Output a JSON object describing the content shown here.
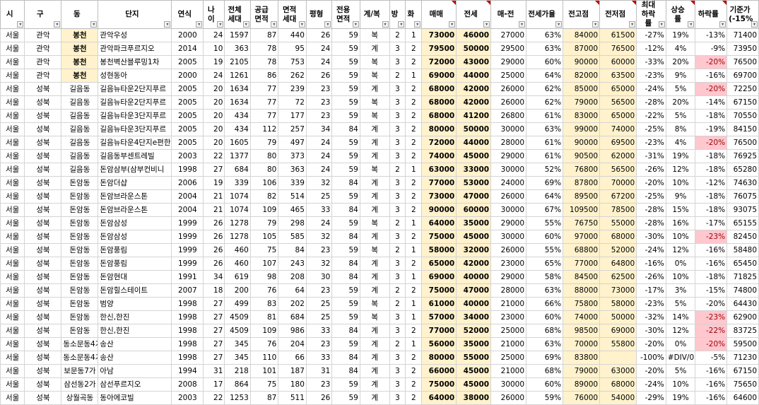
{
  "headers": [
    "시",
    "구",
    "동",
    "단지",
    "연식",
    "나이",
    "전체 세대",
    "공급 면적",
    "면적 세대",
    "평형",
    "전용 면적",
    "계/복",
    "방",
    "화",
    "매매",
    "전세",
    "매-전",
    "전세가율",
    "전고점",
    "전저점",
    "최대 하락률",
    "상승률",
    "하락률",
    "기준가 (-15%"
  ],
  "rows": [
    [
      "서울",
      "관악",
      "봉천",
      "관악우성",
      "2000",
      "24",
      "1597",
      "87",
      "440",
      "26",
      "59",
      "복",
      "2",
      "1",
      "73000",
      "46000",
      "27000",
      "63%",
      "84000",
      "61500",
      "-27%",
      "19%",
      "-13%",
      "71400"
    ],
    [
      "서울",
      "관악",
      "봉천",
      "관악파크푸르지오",
      "2014",
      "10",
      "363",
      "78",
      "95",
      "24",
      "59",
      "계",
      "3",
      "2",
      "79500",
      "50000",
      "29500",
      "63%",
      "87000",
      "76500",
      "-12%",
      "4%",
      "-9%",
      "73950"
    ],
    [
      "서울",
      "관악",
      "봉천",
      "봉천벽산블루밍1차",
      "2005",
      "19",
      "2105",
      "78",
      "753",
      "24",
      "59",
      "복",
      "3",
      "2",
      "72000",
      "43000",
      "29000",
      "60%",
      "90000",
      "60000",
      "-33%",
      "20%",
      "-20%",
      "76500"
    ],
    [
      "서울",
      "관악",
      "봉천",
      "성현동아",
      "2000",
      "24",
      "1261",
      "86",
      "262",
      "26",
      "59",
      "복",
      "2",
      "1",
      "69000",
      "44000",
      "25000",
      "64%",
      "82000",
      "63500",
      "-23%",
      "9%",
      "-16%",
      "69700"
    ],
    [
      "서울",
      "성북",
      "길음동",
      "길음뉴타운2단지푸르",
      "2005",
      "20",
      "1634",
      "77",
      "239",
      "23",
      "59",
      "계",
      "3",
      "2",
      "68000",
      "42000",
      "26000",
      "62%",
      "85000",
      "65000",
      "-24%",
      "5%",
      "-20%",
      "72250"
    ],
    [
      "서울",
      "성북",
      "길음동",
      "길음뉴타운2단지푸르",
      "2005",
      "20",
      "1634",
      "77",
      "72",
      "23",
      "59",
      "복",
      "3",
      "2",
      "68000",
      "42000",
      "26000",
      "62%",
      "79000",
      "56500",
      "-28%",
      "20%",
      "-14%",
      "67150"
    ],
    [
      "서울",
      "성북",
      "길음동",
      "길음뉴타운3단지푸르",
      "2005",
      "20",
      "434",
      "77",
      "177",
      "23",
      "59",
      "복",
      "3",
      "2",
      "68000",
      "41200",
      "26800",
      "61%",
      "83000",
      "65000",
      "-22%",
      "5%",
      "-18%",
      "70550"
    ],
    [
      "서울",
      "성북",
      "길음동",
      "길음뉴타운3단지푸르",
      "2005",
      "20",
      "434",
      "112",
      "257",
      "34",
      "84",
      "계",
      "3",
      "2",
      "80000",
      "50000",
      "30000",
      "63%",
      "99000",
      "74000",
      "-25%",
      "8%",
      "-19%",
      "84150"
    ],
    [
      "서울",
      "성북",
      "길음동",
      "길음뉴타운4단지e편한",
      "2005",
      "20",
      "1605",
      "79",
      "497",
      "24",
      "59",
      "계",
      "3",
      "2",
      "72000",
      "44000",
      "28000",
      "61%",
      "90000",
      "69500",
      "-23%",
      "4%",
      "-20%",
      "76500"
    ],
    [
      "서울",
      "성북",
      "길음동",
      "길음동부센트레빌",
      "2003",
      "22",
      "1377",
      "80",
      "373",
      "24",
      "59",
      "계",
      "3",
      "2",
      "74000",
      "45000",
      "29000",
      "61%",
      "90500",
      "62000",
      "-31%",
      "19%",
      "-18%",
      "76925"
    ],
    [
      "서울",
      "성북",
      "길음동",
      "돈암삼부(삼부컨비니",
      "1998",
      "27",
      "684",
      "80",
      "363",
      "24",
      "59",
      "복",
      "2",
      "1",
      "63000",
      "33000",
      "30000",
      "52%",
      "76800",
      "56500",
      "-26%",
      "12%",
      "-18%",
      "65280"
    ],
    [
      "서울",
      "성북",
      "돈암동",
      "돈암더샵",
      "2006",
      "19",
      "339",
      "106",
      "339",
      "32",
      "84",
      "계",
      "3",
      "2",
      "77000",
      "53000",
      "24000",
      "69%",
      "87800",
      "70000",
      "-20%",
      "10%",
      "-12%",
      "74630"
    ],
    [
      "서울",
      "성북",
      "돈암동",
      "돈암브라운스톤",
      "2004",
      "21",
      "1074",
      "82",
      "514",
      "25",
      "59",
      "계",
      "3",
      "2",
      "73000",
      "47000",
      "26000",
      "64%",
      "89500",
      "67200",
      "-25%",
      "9%",
      "-18%",
      "76075"
    ],
    [
      "서울",
      "성북",
      "돈암동",
      "돈암브라운스톤",
      "2004",
      "21",
      "1074",
      "109",
      "465",
      "33",
      "84",
      "계",
      "3",
      "2",
      "90000",
      "60000",
      "30000",
      "67%",
      "109500",
      "78500",
      "-28%",
      "15%",
      "-18%",
      "93075"
    ],
    [
      "서울",
      "성북",
      "돈암동",
      "돈암삼성",
      "1999",
      "26",
      "1278",
      "79",
      "298",
      "24",
      "59",
      "복",
      "2",
      "1",
      "64000",
      "35000",
      "29000",
      "55%",
      "76750",
      "55000",
      "-28%",
      "16%",
      "-17%",
      "65155"
    ],
    [
      "서울",
      "성북",
      "돈암동",
      "돈암삼성",
      "1999",
      "26",
      "1278",
      "105",
      "585",
      "32",
      "84",
      "계",
      "3",
      "2",
      "75000",
      "45000",
      "30000",
      "60%",
      "97000",
      "68000",
      "-30%",
      "10%",
      "-23%",
      "82450"
    ],
    [
      "서울",
      "성북",
      "돈암동",
      "돈암풍림",
      "1999",
      "26",
      "460",
      "75",
      "84",
      "23",
      "59",
      "복",
      "2",
      "1",
      "58000",
      "32000",
      "26000",
      "55%",
      "68800",
      "52000",
      "-24%",
      "12%",
      "-16%",
      "58480"
    ],
    [
      "서울",
      "성북",
      "돈암동",
      "돈암풍림",
      "1999",
      "26",
      "460",
      "107",
      "243",
      "32",
      "84",
      "계",
      "3",
      "2",
      "65000",
      "42000",
      "23000",
      "65%",
      "77000",
      "64800",
      "-16%",
      "0%",
      "-16%",
      "65450"
    ],
    [
      "서울",
      "성북",
      "돈암동",
      "돈암현대",
      "1991",
      "34",
      "619",
      "98",
      "208",
      "30",
      "84",
      "계",
      "3",
      "1",
      "69000",
      "40000",
      "29000",
      "58%",
      "84500",
      "62500",
      "-26%",
      "10%",
      "-18%",
      "71825"
    ],
    [
      "서울",
      "성북",
      "돈암동",
      "돈암힐스테이트",
      "2007",
      "18",
      "200",
      "76",
      "64",
      "23",
      "59",
      "계",
      "2",
      "2",
      "75000",
      "47000",
      "28000",
      "63%",
      "88000",
      "73000",
      "-17%",
      "3%",
      "-15%",
      "74800"
    ],
    [
      "서울",
      "성북",
      "돈암동",
      "범양",
      "1998",
      "27",
      "499",
      "83",
      "202",
      "25",
      "59",
      "복",
      "2",
      "1",
      "61000",
      "40000",
      "21000",
      "66%",
      "75800",
      "58000",
      "-23%",
      "5%",
      "-20%",
      "64430"
    ],
    [
      "서울",
      "성북",
      "돈암동",
      "한신,한진",
      "1998",
      "27",
      "4509",
      "81",
      "684",
      "25",
      "59",
      "복",
      "3",
      "1",
      "57000",
      "34000",
      "23000",
      "60%",
      "74000",
      "50000",
      "-32%",
      "14%",
      "-23%",
      "62900"
    ],
    [
      "서울",
      "성북",
      "돈암동",
      "한신,한진",
      "1998",
      "27",
      "4509",
      "109",
      "986",
      "33",
      "84",
      "계",
      "3",
      "2",
      "77000",
      "52000",
      "25000",
      "68%",
      "98500",
      "69000",
      "-30%",
      "12%",
      "-22%",
      "83725"
    ],
    [
      "서울",
      "성북",
      "동소문동4가",
      "송산",
      "1998",
      "27",
      "345",
      "76",
      "204",
      "23",
      "59",
      "계",
      "2",
      "1",
      "56000",
      "35000",
      "21000",
      "63%",
      "70000",
      "55800",
      "-20%",
      "0%",
      "-20%",
      "59500"
    ],
    [
      "서울",
      "성북",
      "동소문동4가",
      "송산",
      "1998",
      "27",
      "345",
      "110",
      "66",
      "33",
      "84",
      "계",
      "3",
      "2",
      "80000",
      "55000",
      "25000",
      "69%",
      "83800",
      "",
      "-100%",
      "#DIV/0!",
      "-5%",
      "71230"
    ],
    [
      "서울",
      "성북",
      "보문동7가",
      "아남",
      "1994",
      "31",
      "218",
      "101",
      "187",
      "31",
      "84",
      "계",
      "3",
      "2",
      "66000",
      "45000",
      "21000",
      "68%",
      "79000",
      "63000",
      "-20%",
      "5%",
      "-16%",
      "67150"
    ],
    [
      "서울",
      "성북",
      "삼선동2가",
      "삼선푸르지오",
      "2008",
      "17",
      "864",
      "75",
      "180",
      "23",
      "59",
      "계",
      "3",
      "2",
      "75000",
      "45000",
      "30000",
      "60%",
      "89000",
      "68000",
      "-24%",
      "10%",
      "-16%",
      "75650"
    ],
    [
      "서울",
      "성북",
      "상월곡동",
      "동아에코빌",
      "2003",
      "22",
      "1253",
      "87",
      "511",
      "26",
      "59",
      "계",
      "3",
      "2",
      "64000",
      "38000",
      "26000",
      "59%",
      "76000",
      "54000",
      "-29%",
      "19%",
      "-16%",
      "64600"
    ]
  ],
  "highlight_rows_falling_red": [
    2,
    4,
    8,
    15,
    21,
    22,
    23
  ],
  "filter_icon": "dropdown-arrow-icon"
}
